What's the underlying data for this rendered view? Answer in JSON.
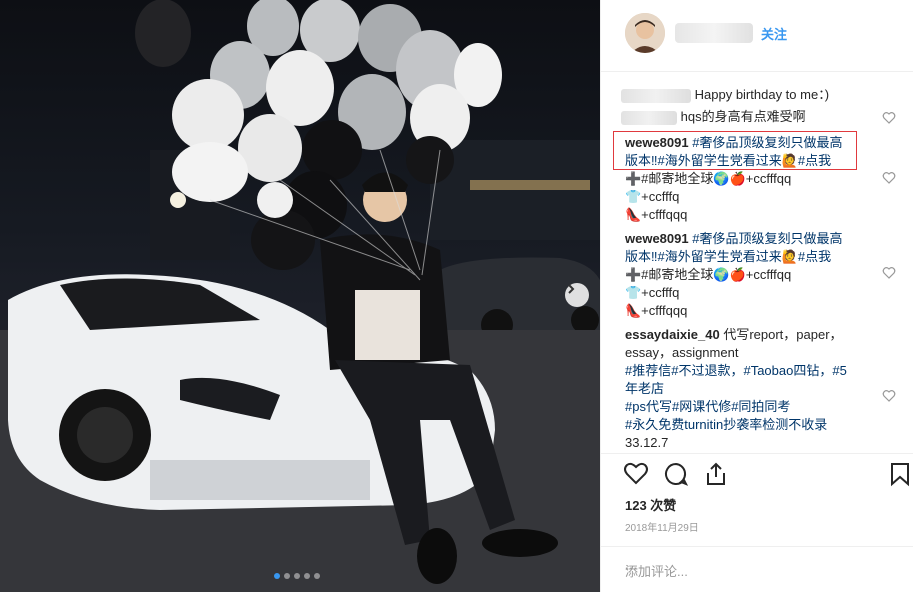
{
  "header": {
    "follow_label": "关注"
  },
  "caption": {
    "text": "Happy birthday to me：)"
  },
  "comments": [
    {
      "text": "hqs的身高有点难受啊"
    },
    {
      "user": "wewe8091",
      "line1": "#奢侈品顶级复刻只做最高",
      "line2": "版本‼#海外留学生党看过来🙋#点我",
      "line3": "➕#邮寄地全球🌍🍎+ccfffqq",
      "line4": "👕+ccfffq",
      "line5": "👠+cfffqqq"
    },
    {
      "user": "wewe8091",
      "line1": "#奢侈品顶级复刻只做最高",
      "line2": "版本‼#海外留学生党看过来🙋#点我",
      "line3": "➕#邮寄地全球🌍🍎+ccfffqq",
      "line4": "👕+ccfffq",
      "line5": "👠+cfffqqq"
    },
    {
      "user": "essaydaixie_40",
      "line1": "代写report，paper，",
      "line2": "essay，assignment",
      "line3": "#推荐信#不过退款，#Taobao四钻，#5",
      "line4": "年老店",
      "line5": "#ps代写#网课代修#同拍同考",
      "line6": "#永久免费turnitin抄袭率检测不收录",
      "line7": "33.12.7"
    }
  ],
  "likes": "123 次赞",
  "date": "2018年11月29日",
  "add_comment_placeholder": "添加评论...",
  "more_label": "···",
  "icons": {
    "like": "heart-outline-icon",
    "comment": "comment-bubble-icon",
    "share": "share-arrow-icon",
    "save": "bookmark-icon",
    "next": "chevron-right-icon"
  },
  "colors": {
    "link": "#003569",
    "follow": "#3897f0",
    "highlight": "#e0393e",
    "muted": "#999999"
  },
  "carousel": {
    "count": 5,
    "active": 1
  }
}
